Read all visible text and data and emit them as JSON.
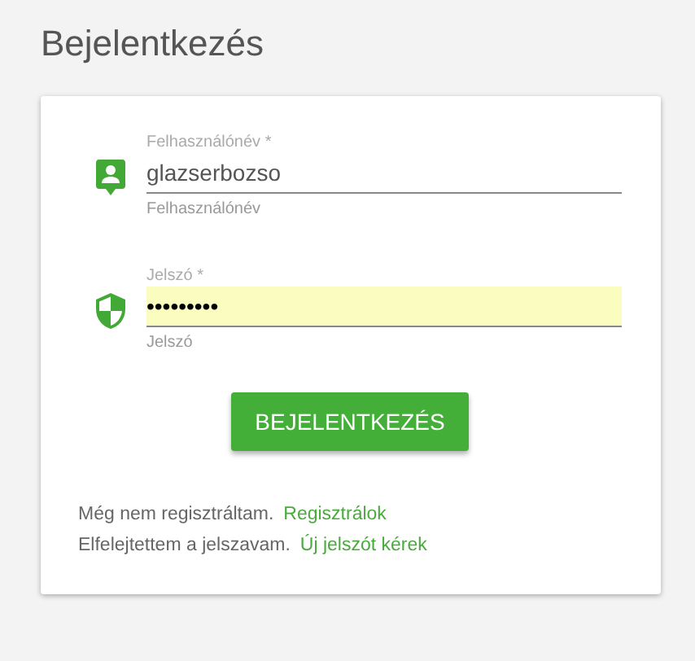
{
  "title": "Bejelentkezés",
  "fields": [
    {
      "kind": "user",
      "label": "Felhasználónév *",
      "value": "glazserbozso",
      "hint": "Felhasználónév",
      "autofilled": false
    },
    {
      "kind": "password",
      "label": "Jelszó *",
      "value": "•••••••••",
      "hint": "Jelszó",
      "autofilled": true
    }
  ],
  "submit": "BEJELENTKEZÉS",
  "links": [
    {
      "text": "Még nem regisztráltam.",
      "link": "Regisztrálok"
    },
    {
      "text": "Elfelejtettem a jelszavam.",
      "link": "Új jelszót kérek"
    }
  ]
}
